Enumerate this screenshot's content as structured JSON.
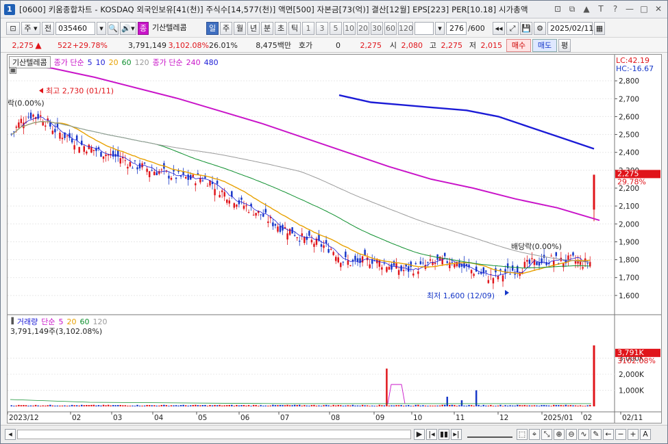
{
  "window": {
    "badge": "1",
    "title": "[0600] 키움종합차트 - KOSDAQ 외국인보유[41(천)] 주식수[14,577(천)] 액면[500] 자본금[73(억)] 결산[12월] EPS[223] PER[10.18] 시가총액",
    "controls": [
      "⊡",
      "⧉",
      "▲",
      "T",
      "?",
      "—",
      "□",
      "✕"
    ]
  },
  "toolbar": {
    "market": "주",
    "market_all": "전",
    "code": "035460",
    "stock_name": "기산텔레콤",
    "periods": [
      "일",
      "주",
      "월",
      "년",
      "분",
      "초",
      "틱"
    ],
    "active_period": "일",
    "intervals": [
      "1",
      "3",
      "5",
      "10",
      "20",
      "30",
      "60",
      "120"
    ],
    "count": "276",
    "count_total": "/600",
    "date": "2025/02/11"
  },
  "quote": {
    "price": "2,275",
    "change": "522",
    "change_pct": "+29.78%",
    "volume": "3,791,149",
    "volume_ratio": "3,102.08%",
    "turnover": "26.01%",
    "amount": "8,475백만",
    "bid_label": "호가",
    "bid_value": "0",
    "ask_price": "2,275",
    "open_label": "시",
    "open": "2,080",
    "high_label": "고",
    "high": "2,275",
    "low_label": "저",
    "low": "2,015",
    "buy": "매수",
    "sell": "매도",
    "avg": "평"
  },
  "price_panel": {
    "name": "기산텔레콤",
    "ma_label": "종가 단순",
    "ma_periods": [
      "5",
      "10",
      "20",
      "60",
      "120"
    ],
    "ma_colors": [
      "#1b1bd6",
      "#1b1bd6",
      "#e8a100",
      "#0d8f2d",
      "#9a9a9a"
    ],
    "ma2_label": "종가 단순",
    "ma2_periods": [
      "240",
      "480"
    ],
    "ma2_colors": [
      "#c914c9",
      "#1b1bd6"
    ],
    "lc": "LC:42.19",
    "hc": "HC:-16.67",
    "current_price_tag": "2,275",
    "current_pct_tag": "29.78%",
    "high_note": "최고 2,730 (01/11)",
    "low_note": "최저 1,600 (12/09)",
    "exdiv_note": "배당락(0.00%)",
    "exdiv_note2": "락(0.00%)"
  },
  "volume_panel": {
    "label": "거래량",
    "ma_label": "단순",
    "ma_periods": [
      "5",
      "20",
      "60",
      "120"
    ],
    "ma_colors": [
      "#c914c9",
      "#e8a100",
      "#0d8f2d",
      "#9a9a9a"
    ],
    "volume_text": "3,791,149주(3,102.08%)",
    "vol_tag": "3,791K",
    "vol_pct_tag": "3102.08%"
  },
  "chart_data": {
    "type": "candlestick",
    "y_axis": [
      "2,800",
      "2,700",
      "2,600",
      "2,500",
      "2,400",
      "2,300",
      "2,200",
      "2,100",
      "2,000",
      "1,900",
      "1,800",
      "1,700",
      "1,600"
    ],
    "y_values": [
      2800,
      2700,
      2600,
      2500,
      2400,
      2300,
      2200,
      2100,
      2000,
      1900,
      1800,
      1700,
      1600
    ],
    "ylim": [
      1500,
      2900
    ],
    "volume_axis": [
      "3,000K",
      "2,000K",
      "1,000K"
    ],
    "volume_values": [
      3000,
      2000,
      1000
    ],
    "x_labels": [
      "2023/12",
      "02",
      "03",
      "04",
      "05",
      "06",
      "07",
      "08",
      "09",
      "10",
      "11",
      "12",
      "2025/01",
      "02",
      "02/11"
    ],
    "close": [
      2500,
      2580,
      2610,
      2600,
      2540,
      2500,
      2480,
      2440,
      2420,
      2400,
      2380,
      2370,
      2330,
      2320,
      2300,
      2290,
      2270,
      2260,
      2250,
      2260,
      2230,
      2180,
      2150,
      2110,
      2080,
      2050,
      2010,
      1980,
      1960,
      1920,
      1900,
      1880,
      1860,
      1800,
      1780,
      1790,
      1800,
      1780,
      1760,
      1740,
      1750,
      1760,
      1780,
      1790,
      1800,
      1760,
      1740,
      1720,
      1700,
      1720,
      1740,
      1760,
      1780,
      1790,
      1800,
      1790,
      1800,
      1780,
      1790,
      2275
    ],
    "price_high": 2730,
    "price_low": 1600,
    "latest": {
      "open": 2080,
      "high": 2275,
      "low": 2015,
      "close": 2275,
      "volume": 3791149
    }
  }
}
